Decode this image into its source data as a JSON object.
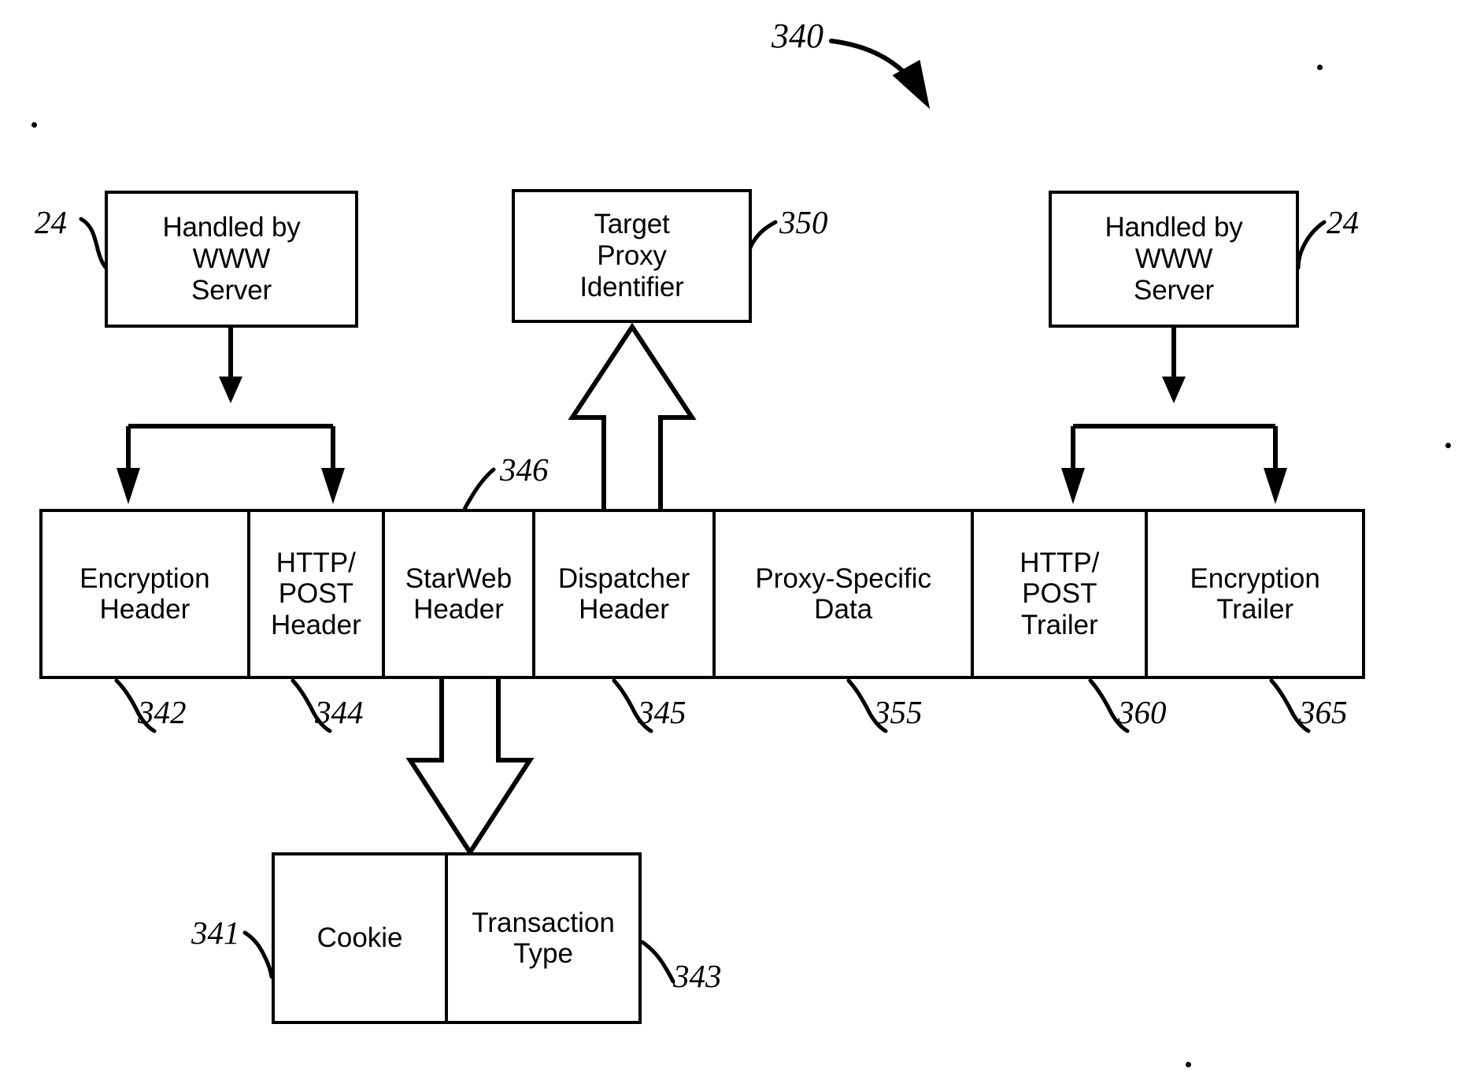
{
  "figure": {
    "number": "340",
    "title_ref": "340"
  },
  "top_boxes": [
    {
      "id": "handled-www-left",
      "label": "Handled by\nWWW\nServer",
      "line1": "Handled by",
      "line2": "WWW",
      "line3": "Server",
      "ref": "24"
    },
    {
      "id": "target-proxy-identifier",
      "label": "Target\nProxy\nIdentifier",
      "line1": "Target",
      "line2": "Proxy",
      "line3": "Identifier",
      "ref": "350"
    },
    {
      "id": "handled-www-right",
      "label": "Handled by\nWWW\nServer",
      "line1": "Handled by",
      "line2": "WWW",
      "line3": "Server",
      "ref": "24"
    }
  ],
  "packet": {
    "ref_starweb": "346",
    "cells": [
      {
        "line1": "Encryption",
        "line2": "Header",
        "ref": "342"
      },
      {
        "line1": "HTTP/",
        "line2": "POST",
        "line3": "Header",
        "ref": "344"
      },
      {
        "line1": "StarWeb",
        "line2": "Header",
        "ref": "346"
      },
      {
        "line1": "Dispatcher",
        "line2": "Header",
        "ref": "345"
      },
      {
        "line1": "Proxy-Specific",
        "line2": "Data",
        "ref": "355"
      },
      {
        "line1": "HTTP/",
        "line2": "POST",
        "line3": "Trailer",
        "ref": "360"
      },
      {
        "line1": "Encryption",
        "line2": "Trailer",
        "ref": "365"
      }
    ]
  },
  "starweb_detail": {
    "cells": [
      {
        "line1": "Cookie",
        "ref": "341"
      },
      {
        "line1": "Transaction",
        "line2": "Type",
        "ref": "343"
      }
    ]
  },
  "refs": {
    "fig": "340",
    "www_left": "24",
    "www_right": "24",
    "target_proxy": "350",
    "starweb": "346",
    "encryption_header": "342",
    "http_post_header": "344",
    "dispatcher_header": "345",
    "proxy_specific_data": "355",
    "http_post_trailer": "360",
    "encryption_trailer": "365",
    "cookie": "341",
    "transaction_type": "343"
  },
  "colors": {
    "ink": "#000000",
    "paper": "#ffffff"
  }
}
